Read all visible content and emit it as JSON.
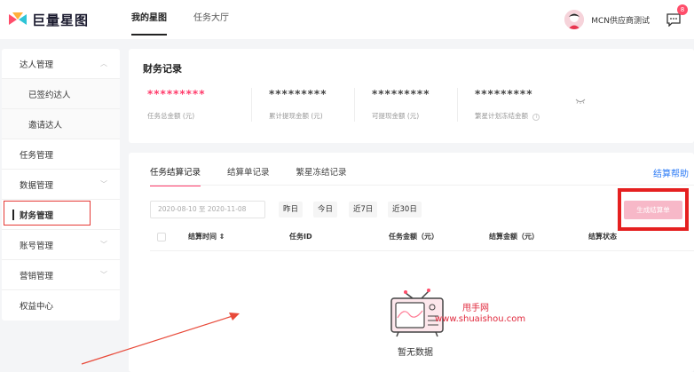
{
  "header": {
    "logo_text": "巨量星图",
    "nav": [
      "我的星图",
      "任务大厅"
    ],
    "user_name": "MCN供应商测试",
    "message_badge": "8"
  },
  "sidebar": {
    "items": [
      {
        "label": "达人管理",
        "chevron": "︿"
      },
      {
        "label": "已签约达人"
      },
      {
        "label": "邀请达人"
      },
      {
        "label": "任务管理"
      },
      {
        "label": "数据管理",
        "chevron": "﹀"
      },
      {
        "label": "财务管理"
      },
      {
        "label": "账号管理",
        "chevron": "﹀"
      },
      {
        "label": "营销管理",
        "chevron": "﹀"
      },
      {
        "label": "权益中心"
      }
    ]
  },
  "finance": {
    "title": "财务记录",
    "stats": [
      {
        "value": "*********",
        "label": "任务总金额 (元)"
      },
      {
        "value": "*********",
        "label": "累计提现金额 (元)"
      },
      {
        "value": "*********",
        "label": "可提现金额 (元)"
      },
      {
        "value": "*********",
        "label": "繁星计划冻结金额"
      }
    ]
  },
  "records": {
    "tabs": [
      "任务结算记录",
      "结算单记录",
      "繁星冻结记录"
    ],
    "help": "结算帮助",
    "date_range": "2020-08-10 至 2020-11-08",
    "quick_filters": [
      "昨日",
      "今日",
      "近7日",
      "近30日"
    ],
    "generate_button": "生成结算单",
    "columns": [
      "结算时间 ⇕",
      "任务ID",
      "任务金额（元）",
      "结算金额（元）",
      "结算状态"
    ],
    "empty_text": "暂无数据"
  },
  "watermark": {
    "line1": "甩手网",
    "line2": "www.shuaishou.com"
  },
  "colors": {
    "accent_pink": "#ff3b6b",
    "link_blue": "#2e7cf6",
    "annotation_red": "#e52020"
  }
}
